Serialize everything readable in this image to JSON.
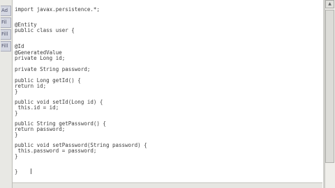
{
  "left_tabs": [
    "Ad",
    "Fil",
    "Fill",
    "Fill"
  ],
  "code_lines": [
    "import javax.persistence.*;",
    "@Entity",
    "public class user {",
    "@Id",
    "@GeneratedValue",
    "private Long id;",
    "private String password;",
    "public Long getId() {",
    "return id;",
    "}",
    "public void setId(Long id) {",
    " this.id = id;",
    "}",
    "public String getPassword() {",
    "return password;",
    "}",
    "public void setPassword(String password) {",
    " this.password = password;",
    "}",
    "}"
  ],
  "scrollbar": {
    "up_arrow_icon": "triangle-up-icon"
  }
}
